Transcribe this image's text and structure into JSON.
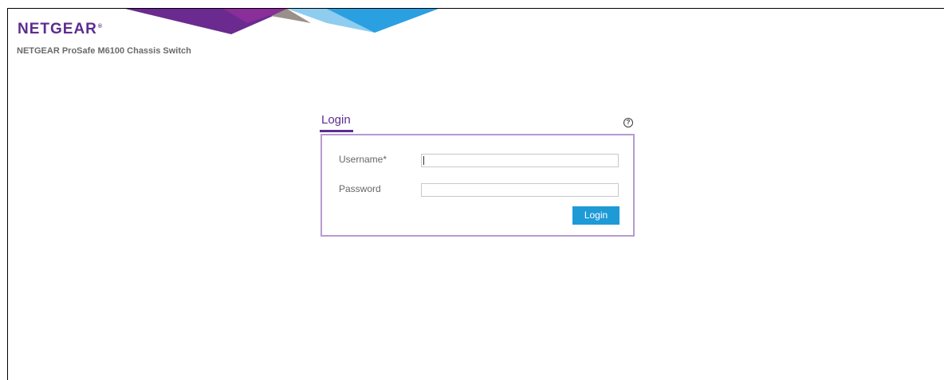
{
  "brand": {
    "logo_text": "NETGEAR",
    "trademark": "®",
    "product_name": "NETGEAR ProSafe M6100 Chassis Switch",
    "brand_color": "#5c2d8f"
  },
  "login": {
    "title": "Login",
    "help_icon": "help-circle-icon",
    "username_label": "Username*",
    "username_value": "",
    "password_label": "Password",
    "password_value": "",
    "submit_label": "Login",
    "button_color": "#1e9ad7",
    "border_color": "#b69ad1"
  }
}
